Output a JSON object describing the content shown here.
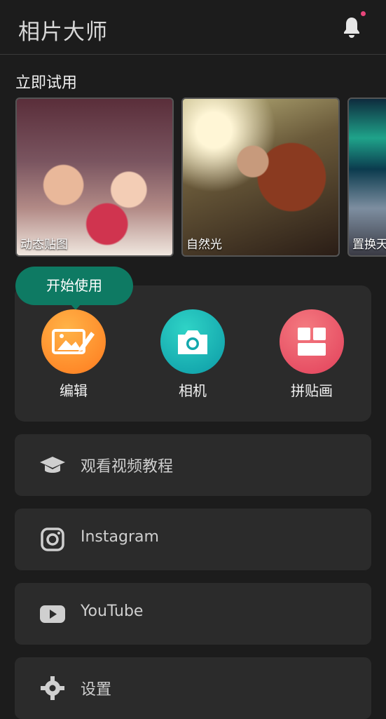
{
  "header": {
    "title": "相片大师",
    "notification_icon": "bell-icon",
    "badge_color": "#e8457a"
  },
  "try_now": {
    "title": "立即试用",
    "cards": [
      {
        "label": "动态贴图"
      },
      {
        "label": "自然光"
      },
      {
        "label": "置换天"
      }
    ]
  },
  "tooltip": {
    "text": "开始使用"
  },
  "tools": [
    {
      "label": "编辑",
      "icon": "edit-image-icon",
      "color": "#ff9a2f"
    },
    {
      "label": "相机",
      "icon": "camera-icon",
      "color": "#1fb9b0"
    },
    {
      "label": "拼贴画",
      "icon": "collage-icon",
      "color": "#e85566"
    }
  ],
  "menu": [
    {
      "label": "观看视频教程",
      "icon": "graduation-cap-icon"
    },
    {
      "label": "Instagram",
      "icon": "instagram-icon"
    },
    {
      "label": "YouTube",
      "icon": "youtube-icon"
    },
    {
      "label": "设置",
      "icon": "gear-icon"
    }
  ]
}
